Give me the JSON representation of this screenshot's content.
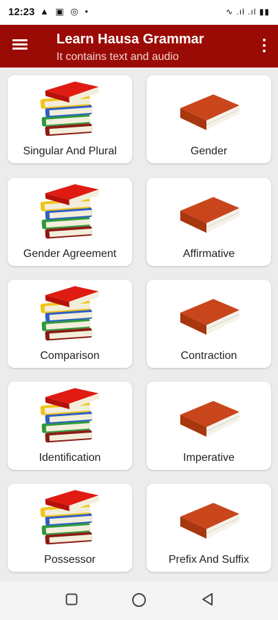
{
  "status": {
    "time": "12:23",
    "left_icons": "▲ ▣ ◎ •",
    "right_icons": "∿ .ıl .ıl ▮▮"
  },
  "appbar": {
    "title": "Learn Hausa Grammar",
    "subtitle": "It contains text and audio"
  },
  "topics": [
    {
      "label": "Singular And Plural",
      "icon": "book-stack-icon"
    },
    {
      "label": "Gender",
      "icon": "book-icon"
    },
    {
      "label": "Gender Agreement",
      "icon": "book-stack-icon"
    },
    {
      "label": "Affirmative",
      "icon": "book-icon"
    },
    {
      "label": "Comparison",
      "icon": "book-stack-icon"
    },
    {
      "label": "Contraction",
      "icon": "book-icon"
    },
    {
      "label": "Identification",
      "icon": "book-stack-icon"
    },
    {
      "label": "Imperative",
      "icon": "book-icon"
    },
    {
      "label": "Possessor",
      "icon": "book-stack-icon"
    },
    {
      "label": "Prefix And Suffix",
      "icon": "book-icon"
    }
  ],
  "colors": {
    "appbar": "#9b0b05",
    "book": "#c9461c"
  }
}
